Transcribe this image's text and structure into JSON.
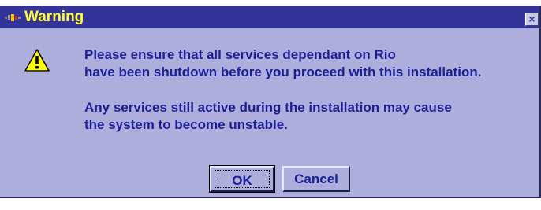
{
  "window": {
    "title": "Warning",
    "close_symbol": "×",
    "app_icon": "window-app-icon",
    "close_icon": "close-icon"
  },
  "message": {
    "icon": "warning-icon",
    "lines": [
      "Please ensure that all services dependant on Rio",
      "have been shutdown before you proceed with this installation.",
      "Any services still active during the installation may cause",
      "the system to become unstable."
    ]
  },
  "buttons": {
    "ok_label": "OK",
    "cancel_label": "Cancel"
  },
  "colors": {
    "titlebar": "#333399",
    "title_text": "#ffff33",
    "dialog_bg": "#aeaedc",
    "text": "#1e1e96",
    "warning_icon": "#ffff00"
  }
}
